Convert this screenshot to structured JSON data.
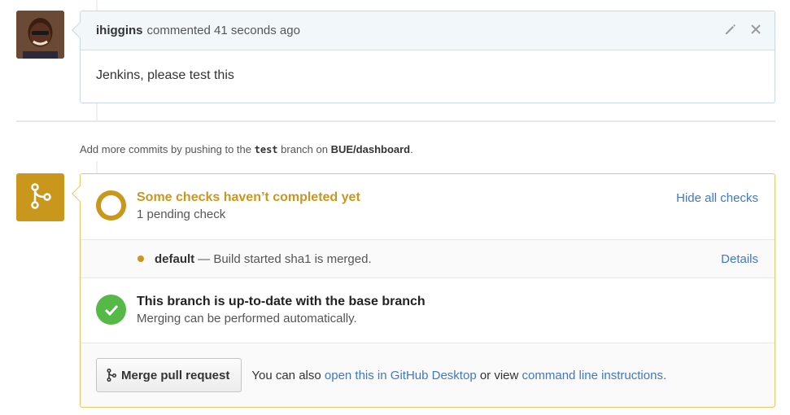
{
  "comment": {
    "author": "ihiggins",
    "meta": "commented 41 seconds ago",
    "body": "Jenkins, please test this"
  },
  "push_hint": {
    "prefix": "Add more commits by pushing to the",
    "branch": "test",
    "middle": "branch on",
    "repo": "BUE/dashboard",
    "suffix": "."
  },
  "checks": {
    "title": "Some checks haven’t completed yet",
    "subtitle": "1 pending check",
    "hide_link": "Hide all checks",
    "items": [
      {
        "name": "default",
        "description": "— Build started sha1 is merged.",
        "link": "Details"
      }
    ]
  },
  "branch_status": {
    "title": "This branch is up-to-date with the base branch",
    "subtitle": "Merging can be performed automatically."
  },
  "merge": {
    "button_label": "Merge pull request",
    "text_prefix": "You can also",
    "desktop_link": "open this in GitHub Desktop",
    "text_middle": "or view",
    "cli_link": "command line instructions",
    "text_suffix": "."
  },
  "colors": {
    "pending": "#c9971c",
    "success": "#55b847",
    "link": "#4078c0"
  }
}
